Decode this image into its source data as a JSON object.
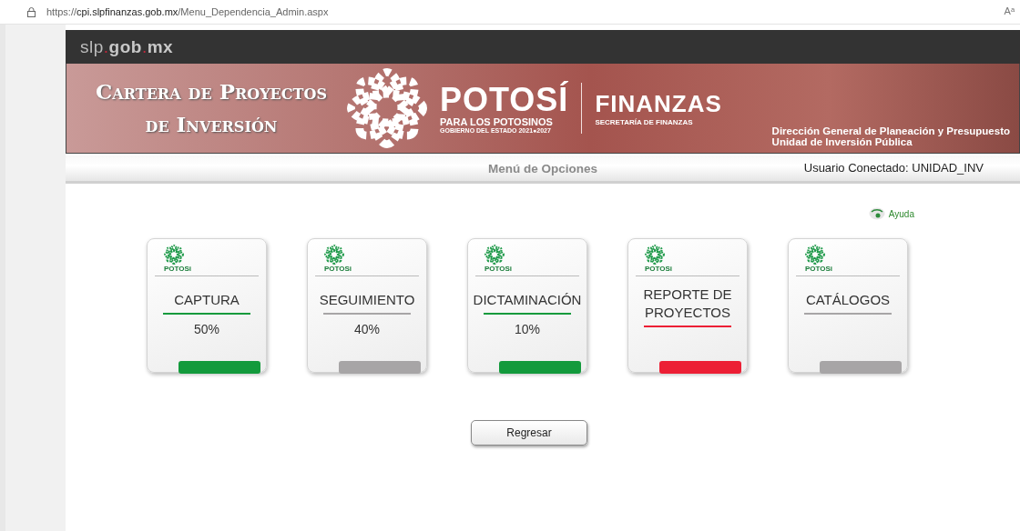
{
  "browser": {
    "url_prefix": "https://",
    "url_host": "cpi.slpfinanzas.gob.mx",
    "url_path": "/Menu_Dependencia_Admin.aspx",
    "reader_label": "Aᵃ"
  },
  "site_bar": {
    "brand_parts": [
      "slp",
      ".",
      "gob",
      ".",
      "mx"
    ]
  },
  "banner": {
    "title_line_1": "Cartera de Proyectos",
    "title_line_2": "de Inversión",
    "logo_word": "POTOSÍ",
    "logo_tagline": "PARA LOS POTOSINOS",
    "logo_term": "GOBIERNO DEL ESTADO 2021●2027",
    "agency": "FINANZAS",
    "agency_sub": "SECRETARÍA DE FINANZAS",
    "unit_line_1": "Dirección General de Planeación y Presupuesto",
    "unit_line_2": "Unidad de Inversión Pública"
  },
  "menu_bar": {
    "title": "Menú de Opciones",
    "user": "Usuario Conectado: UNIDAD_INV"
  },
  "help_link": "Ayuda",
  "cards": [
    {
      "logo_text": "POTOSi",
      "label": "CAPTURA",
      "percent": "50%",
      "color": "#139a3c"
    },
    {
      "logo_text": "POTOSi",
      "label": "SEGUIMIENTO",
      "percent": "40%",
      "color": "#a7a5a6"
    },
    {
      "logo_text": "POTOSi",
      "label": "DICTAMINACIÓN",
      "percent": "10%",
      "color": "#139a3c"
    },
    {
      "logo_text": "POTOSi",
      "label": "REPORTE DE PROYECTOS",
      "color": "#ec1f35"
    },
    {
      "logo_text": "POTOSi",
      "label": "CATÁLOGOS",
      "color": "#a7a5a6"
    }
  ],
  "back_button": "Regresar"
}
